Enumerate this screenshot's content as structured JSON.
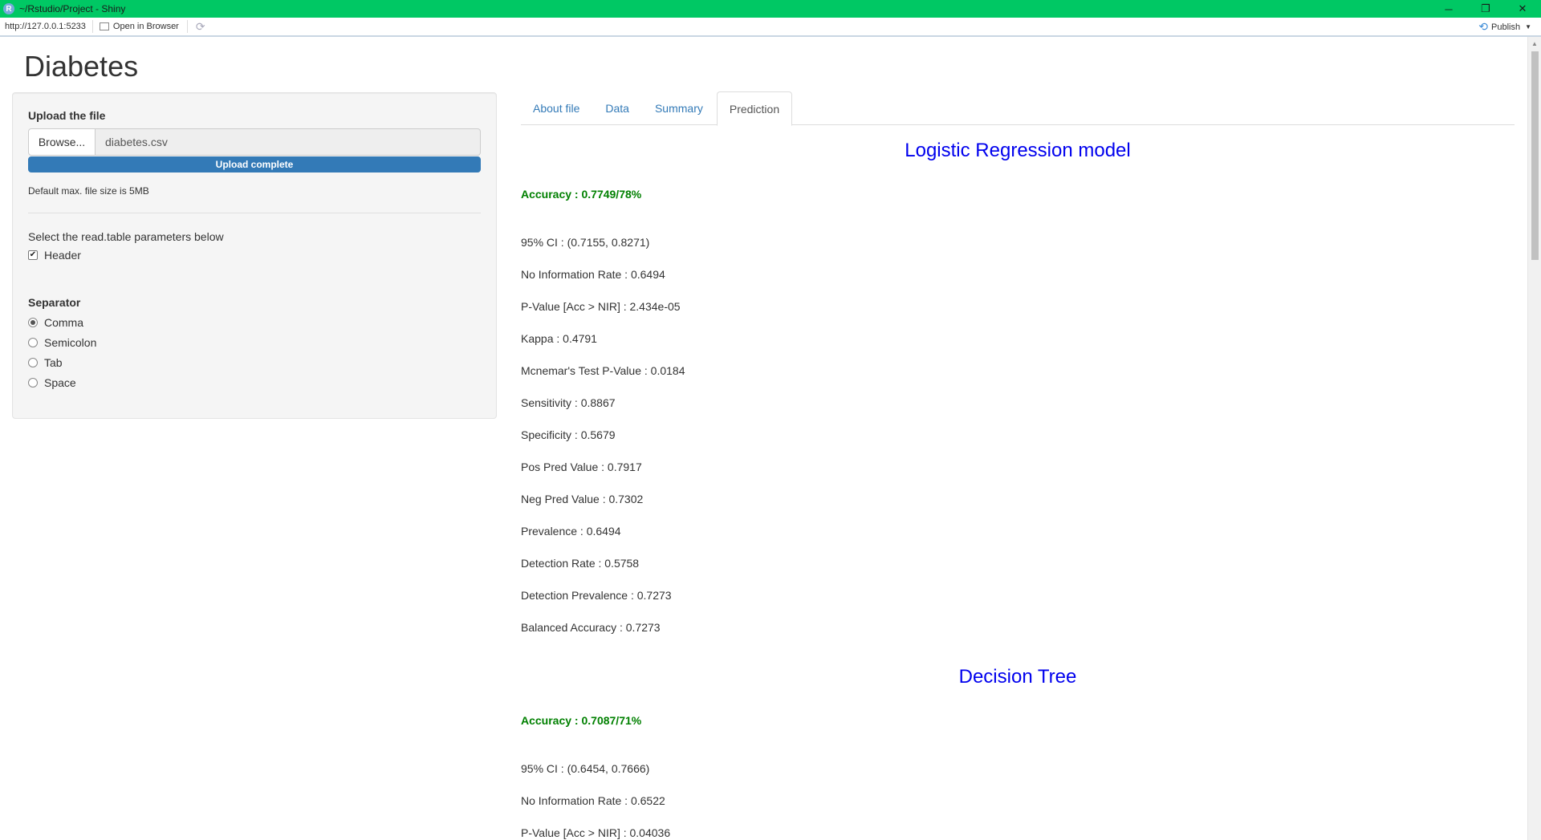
{
  "window": {
    "title": "~/Rstudio/Project - Shiny",
    "app_icon": "R",
    "minimize": "─",
    "maximize": "❐",
    "close": "✕"
  },
  "addressbar": {
    "url": "http://127.0.0.1:5233",
    "open_in_browser": "Open in Browser",
    "refresh_icon": "⟳",
    "publish": "Publish",
    "publish_caret": "▼",
    "publish_icon": "⟲"
  },
  "page": {
    "title": "Diabetes"
  },
  "sidebar": {
    "upload_label": "Upload the file",
    "browse_button": "Browse...",
    "file_name": "diabetes.csv",
    "progress_label": "Upload complete",
    "progress_fraction": 1.0,
    "max_size_note": "Default max. file size is 5MB",
    "params_label": "Select the read.table parameters below",
    "header_checkbox": {
      "label": "Header",
      "checked": true,
      "mark": "✔"
    },
    "separator_label": "Separator",
    "separator_options": [
      {
        "label": "Comma",
        "checked": true
      },
      {
        "label": "Semicolon",
        "checked": false
      },
      {
        "label": "Tab",
        "checked": false
      },
      {
        "label": "Space",
        "checked": false
      }
    ]
  },
  "tabs": [
    {
      "label": "About file",
      "active": false
    },
    {
      "label": "Data",
      "active": false
    },
    {
      "label": "Summary",
      "active": false
    },
    {
      "label": "Prediction",
      "active": true
    }
  ],
  "logistic": {
    "title": "Logistic Regression model",
    "accuracy": "Accuracy : 0.7749/78%",
    "stats": [
      "95% CI : (0.7155, 0.8271)",
      "No Information Rate : 0.6494",
      "P-Value [Acc > NIR] : 2.434e-05",
      "Kappa : 0.4791",
      "Mcnemar's Test P-Value : 0.0184",
      "Sensitivity : 0.8867",
      "Specificity : 0.5679",
      "Pos Pred Value : 0.7917",
      "Neg Pred Value : 0.7302",
      "Prevalence : 0.6494",
      "Detection Rate : 0.5758",
      "Detection Prevalence : 0.7273",
      "Balanced Accuracy : 0.7273"
    ]
  },
  "tree": {
    "title": "Decision Tree",
    "accuracy": "Accuracy : 0.7087/71%",
    "stats": [
      "95% CI : (0.6454, 0.7666)",
      "No Information Rate : 0.6522",
      "P-Value [Acc > NIR] : 0.04036"
    ]
  }
}
